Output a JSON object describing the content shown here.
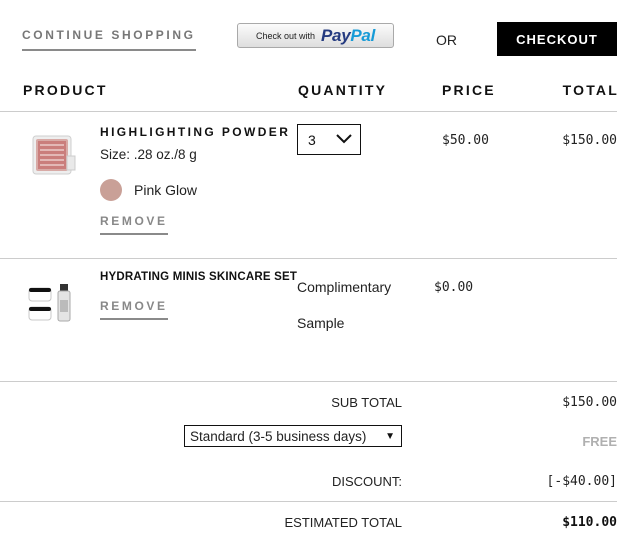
{
  "top_bar": {
    "continue_label": "CONTINUE SHOPPING",
    "paypal_prefix": "Check out with",
    "paypal_logo_part1": "Pay",
    "paypal_logo_part2": "Pal",
    "or_label": "OR",
    "checkout_label": "CHECKOUT"
  },
  "table_headers": {
    "product": "PRODUCT",
    "quantity": "QUANTITY",
    "price": "PRICE",
    "total": "TOTAL"
  },
  "items": [
    {
      "name": "HIGHLIGHTING POWDER",
      "size": "Size: .28 oz./8 g",
      "shade": "Pink Glow",
      "shade_color": "#c9a097",
      "quantity": "3",
      "price": "$50.00",
      "total": "$150.00",
      "remove_label": "REMOVE",
      "thumbnail_icon": "compact-powder-icon"
    },
    {
      "name": "HYDRATING MINIS SKINCARE SET",
      "quantity_text_line1": "Complimentary",
      "quantity_text_line2": "Sample",
      "price": "$0.00",
      "remove_label": "REMOVE",
      "thumbnail_icon": "skincare-jars-icon"
    }
  ],
  "summary": {
    "subtotal_label": "SUB TOTAL",
    "subtotal_value": "$150.00",
    "shipping_selected": "Standard (3-5 business days)",
    "shipping_value": "FREE",
    "discount_label": "DISCOUNT:",
    "discount_value": "[-$40.00]",
    "estimated_total_label": "ESTIMATED TOTAL",
    "estimated_total_value": "$110.00"
  },
  "colors": {
    "checkout_bg": "#000000",
    "paypal_dark": "#253b80",
    "paypal_light": "#179bd7",
    "free_text": "#b0b0b0"
  }
}
